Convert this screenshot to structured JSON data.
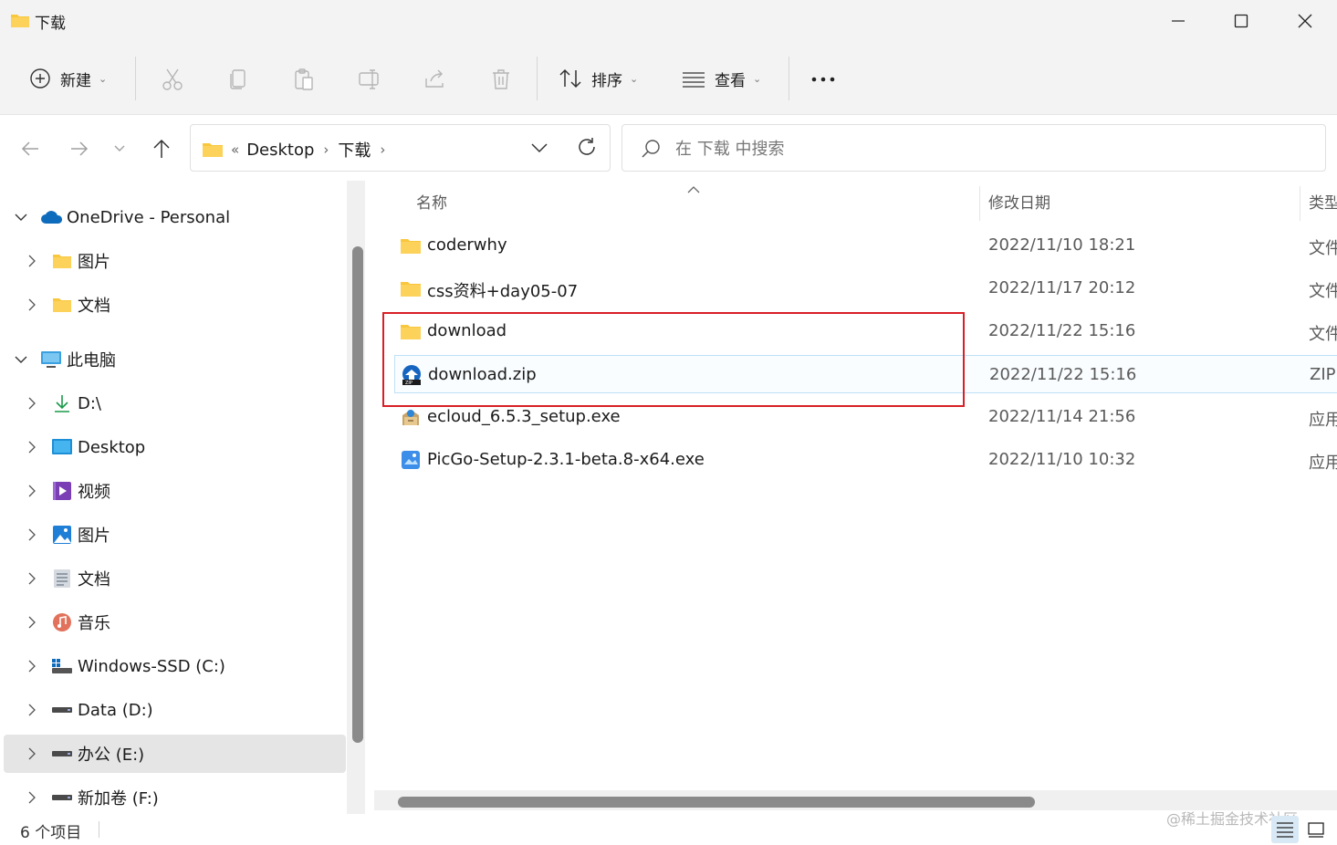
{
  "window": {
    "title": "下载"
  },
  "toolbar": {
    "new_label": "新建",
    "sort_label": "排序",
    "view_label": "查看"
  },
  "address": {
    "crumbs": [
      "Desktop",
      "下载"
    ],
    "overflow": "«"
  },
  "search": {
    "placeholder": "在 下载 中搜索"
  },
  "sidebar": {
    "items": [
      {
        "label": "OneDrive - Personal",
        "icon": "cloud-icon",
        "expanded": true
      },
      {
        "label": "图片",
        "icon": "folder-icon"
      },
      {
        "label": "文档",
        "icon": "folder-icon"
      },
      {
        "label": "此电脑",
        "icon": "computer-icon",
        "expanded": true
      },
      {
        "label": "D:\\",
        "icon": "download-arrow-icon"
      },
      {
        "label": "Desktop",
        "icon": "desktop-icon"
      },
      {
        "label": "视频",
        "icon": "video-icon"
      },
      {
        "label": "图片",
        "icon": "pictures-icon"
      },
      {
        "label": "文档",
        "icon": "documents-icon"
      },
      {
        "label": "音乐",
        "icon": "music-icon"
      },
      {
        "label": "Windows-SSD (C:)",
        "icon": "windows-drive-icon"
      },
      {
        "label": "Data (D:)",
        "icon": "drive-icon"
      },
      {
        "label": "办公 (E:)",
        "icon": "drive-icon",
        "selected": true
      },
      {
        "label": "新加卷 (F:)",
        "icon": "drive-icon"
      }
    ]
  },
  "columns": {
    "name": "名称",
    "date": "修改日期",
    "type": "类型"
  },
  "files": [
    {
      "name": "coderwhy",
      "date": "2022/11/10 18:21",
      "type": "文件",
      "icon": "folder-icon"
    },
    {
      "name": "css资料+day05-07",
      "date": "2022/11/17 20:12",
      "type": "文件",
      "icon": "folder-icon"
    },
    {
      "name": "download",
      "date": "2022/11/22 15:16",
      "type": "文件",
      "icon": "folder-icon"
    },
    {
      "name": "download.zip",
      "date": "2022/11/22 15:16",
      "type": "ZIP",
      "icon": "zip-icon",
      "selected": true
    },
    {
      "name": "ecloud_6.5.3_setup.exe",
      "date": "2022/11/14 21:56",
      "type": "应用",
      "icon": "installer-icon"
    },
    {
      "name": "PicGo-Setup-2.3.1-beta.8-x64.exe",
      "date": "2022/11/10 10:32",
      "type": "应用",
      "icon": "app-icon"
    }
  ],
  "status": {
    "count": "6 个项目",
    "watermark": "@稀土掘金技术社区"
  },
  "colors": {
    "folder": "#f9c73d",
    "accent": "#0067c0",
    "highlight": "#d71f26"
  }
}
